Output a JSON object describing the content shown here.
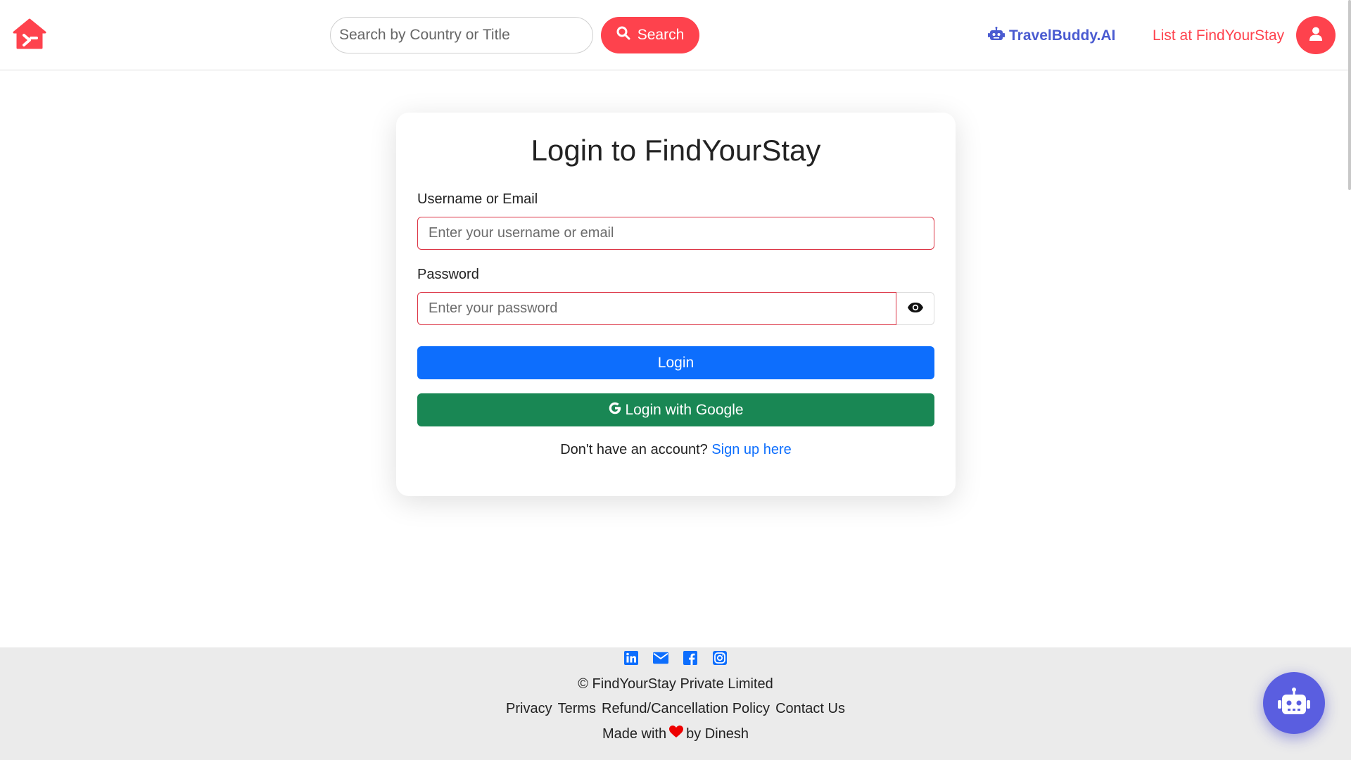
{
  "colors": {
    "brand": "#fe424d",
    "primary": "#0d6efd",
    "google_green": "#198754",
    "travelbuddy": "#4a5bd1",
    "chatbot": "#5a5ee0",
    "error_border": "#dc3545",
    "footer_bg": "#ebebeb"
  },
  "icons": {
    "logo": "house-logo-icon",
    "search": "magnifier-icon",
    "travelbuddy": "robot-icon",
    "avatar": "user-icon",
    "password_toggle": "eye-icon",
    "google": "google-g-icon",
    "social": [
      "linkedin-icon",
      "envelope-icon",
      "facebook-icon",
      "instagram-icon"
    ],
    "heart": "heart-icon",
    "chatbot": "robot-icon"
  },
  "navbar": {
    "search_placeholder": "Search by Country or Title",
    "search_button": "Search",
    "travelbuddy_label": "TravelBuddy.AI",
    "list_label": "List at FindYourStay"
  },
  "login": {
    "title": "Login to FindYourStay",
    "username_label": "Username or Email",
    "username_placeholder": "Enter your username or email",
    "password_label": "Password",
    "password_placeholder": "Enter your password",
    "login_button": "Login",
    "google_button": "Login with Google",
    "signup_prompt": "Don't have an account?",
    "signup_link": "Sign up here"
  },
  "footer": {
    "copyright": "© FindYourStay Private Limited",
    "links": [
      "Privacy",
      "Terms",
      "Refund/Cancellation Policy",
      "Contact Us"
    ],
    "made_with": "Made with",
    "by": "by Dinesh"
  }
}
